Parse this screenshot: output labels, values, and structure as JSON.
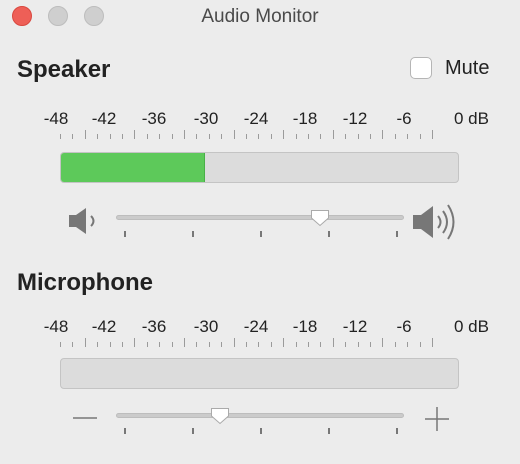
{
  "window": {
    "title": "Audio Monitor"
  },
  "icons": {
    "close": "close-button",
    "minimize": "minimize-button",
    "zoom": "zoom-button",
    "volume_low": "speaker-low-icon",
    "volume_high": "speaker-high-icon",
    "minus": "minus-icon",
    "plus": "plus-icon"
  },
  "colors": {
    "meter_fill": "#5dc95a",
    "close": "#ee5f57",
    "window_bg": "#ececec"
  },
  "speaker": {
    "title": "Speaker",
    "mute_label": "Mute",
    "mute_checked": false,
    "scale_labels": [
      "-48",
      "-42",
      "-36",
      "-30",
      "-24",
      "-18",
      "-12",
      "-6",
      "0 dB"
    ],
    "level_fraction": 0.36,
    "volume_fraction": 0.71
  },
  "microphone": {
    "title": "Microphone",
    "scale_labels": [
      "-48",
      "-42",
      "-36",
      "-30",
      "-24",
      "-18",
      "-12",
      "-6",
      "0 dB"
    ],
    "level_fraction": 0.0,
    "gain_fraction": 0.36
  }
}
